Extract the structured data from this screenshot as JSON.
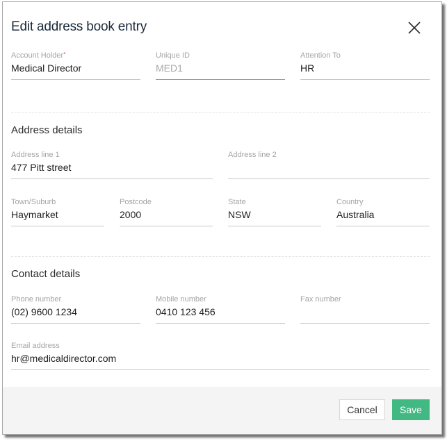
{
  "dialog": {
    "title": "Edit address book entry",
    "close_icon": "close-icon"
  },
  "account": {
    "account_holder": {
      "label": "Account Holder",
      "required_mark": "*",
      "value": "Medical Director"
    },
    "unique_id": {
      "label": "Unique ID",
      "value": "MED1",
      "disabled": true
    },
    "attention_to": {
      "label": "Attention To",
      "value": "HR"
    }
  },
  "address": {
    "section_title": "Address details",
    "line1": {
      "label": "Address line 1",
      "value": "477 Pitt street"
    },
    "line2": {
      "label": "Address line 2",
      "value": ""
    },
    "town": {
      "label": "Town/Suburb",
      "value": "Haymarket"
    },
    "postcode": {
      "label": "Postcode",
      "value": "2000"
    },
    "state": {
      "label": "State",
      "value": "NSW"
    },
    "country": {
      "label": "Country",
      "value": "Australia"
    }
  },
  "contact": {
    "section_title": "Contact details",
    "phone": {
      "label": "Phone number",
      "value": "(02) 9600 1234"
    },
    "mobile": {
      "label": "Mobile number",
      "value": "0410 123 456"
    },
    "fax": {
      "label": "Fax number",
      "value": ""
    },
    "email": {
      "label": "Email address",
      "value": "hr@medicaldirector.com"
    }
  },
  "footer": {
    "cancel_label": "Cancel",
    "save_label": "Save"
  },
  "colors": {
    "save_button": "#42b883",
    "required_mark": "#e04040",
    "title_text": "#1b2a3a"
  }
}
